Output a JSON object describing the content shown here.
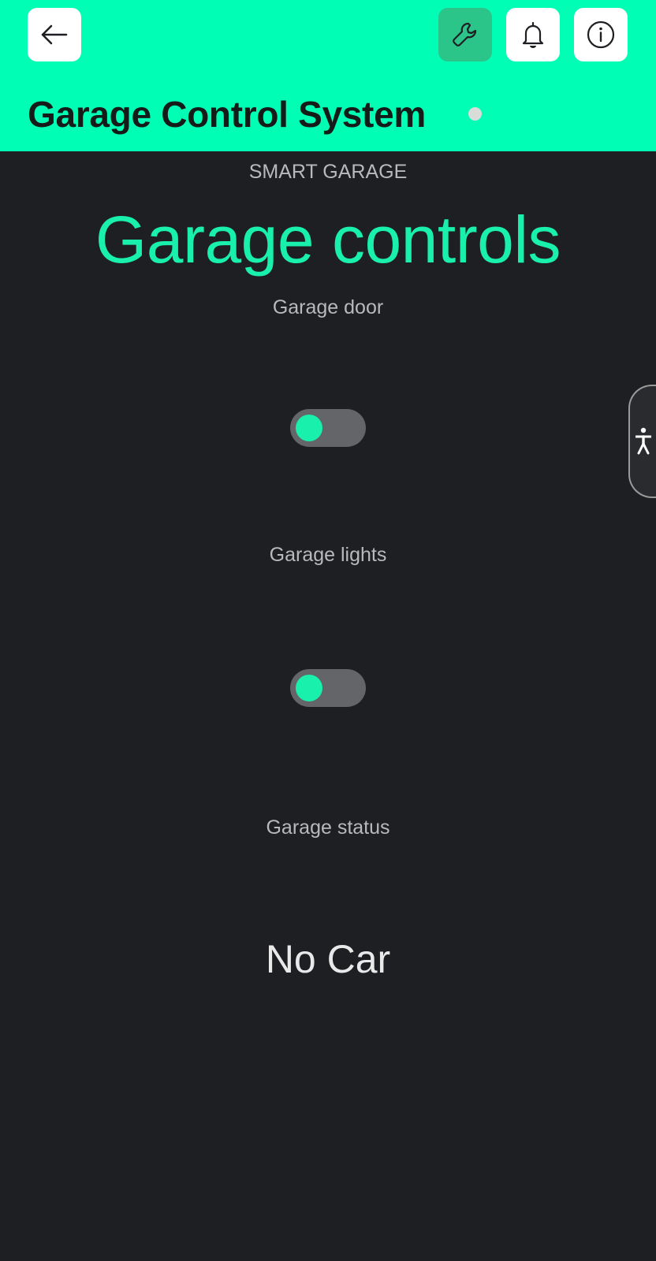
{
  "header": {
    "title": "Garage Control System",
    "background_color": "#00ffb4",
    "buttons": {
      "back": {
        "icon": "arrow-left-icon"
      },
      "tool": {
        "icon": "wrench-icon"
      },
      "notifications": {
        "icon": "bell-icon"
      },
      "info": {
        "icon": "info-icon"
      }
    },
    "status_indicator_color": "#d8ddda"
  },
  "main": {
    "eyebrow": "SMART GARAGE",
    "heading": "Garage controls",
    "controls": [
      {
        "label": "Garage door",
        "type": "toggle",
        "on": false
      },
      {
        "label": "Garage lights",
        "type": "toggle",
        "on": false
      }
    ],
    "status": {
      "label": "Garage status",
      "value": "No Car"
    }
  },
  "colors": {
    "accent": "#18f0ab",
    "background": "#1e1f23",
    "toggle_track": "#646569"
  },
  "accessibility": {
    "icon": "accessibility-person-icon"
  }
}
